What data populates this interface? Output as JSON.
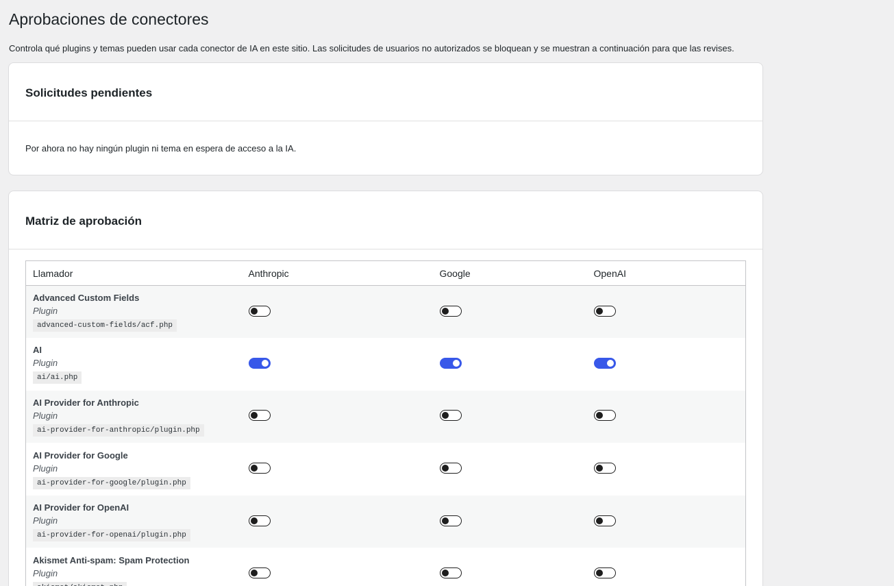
{
  "page": {
    "title": "Aprobaciones de conectores",
    "description": "Controla qué plugins y temas pueden usar cada conector de IA en este sitio. Las solicitudes de usuarios no autorizados se bloquean y se muestran a continuación para que las revises."
  },
  "pending": {
    "title": "Solicitudes pendientes",
    "empty_text": "Por ahora no hay ningún plugin ni tema en espera de acceso a la IA."
  },
  "matrix": {
    "title": "Matriz de aprobación",
    "columns": {
      "caller": "Llamador",
      "anthropic": "Anthropic",
      "google": "Google",
      "openai": "OpenAI"
    },
    "rows": [
      {
        "name": "Advanced Custom Fields",
        "type": "Plugin",
        "file": "advanced-custom-fields/acf.php",
        "anthropic": false,
        "google": false,
        "openai": false
      },
      {
        "name": "AI",
        "type": "Plugin",
        "file": "ai/ai.php",
        "anthropic": true,
        "google": true,
        "openai": true
      },
      {
        "name": "AI Provider for Anthropic",
        "type": "Plugin",
        "file": "ai-provider-for-anthropic/plugin.php",
        "anthropic": false,
        "google": false,
        "openai": false
      },
      {
        "name": "AI Provider for Google",
        "type": "Plugin",
        "file": "ai-provider-for-google/plugin.php",
        "anthropic": false,
        "google": false,
        "openai": false
      },
      {
        "name": "AI Provider for OpenAI",
        "type": "Plugin",
        "file": "ai-provider-for-openai/plugin.php",
        "anthropic": false,
        "google": false,
        "openai": false
      },
      {
        "name": "Akismet Anti-spam: Spam Protection",
        "type": "Plugin",
        "file": "akismet/akismet.php",
        "anthropic": false,
        "google": false,
        "openai": false
      }
    ]
  },
  "colors": {
    "toggle_on": "#3858e9",
    "toggle_off": "#1e1e1e"
  }
}
